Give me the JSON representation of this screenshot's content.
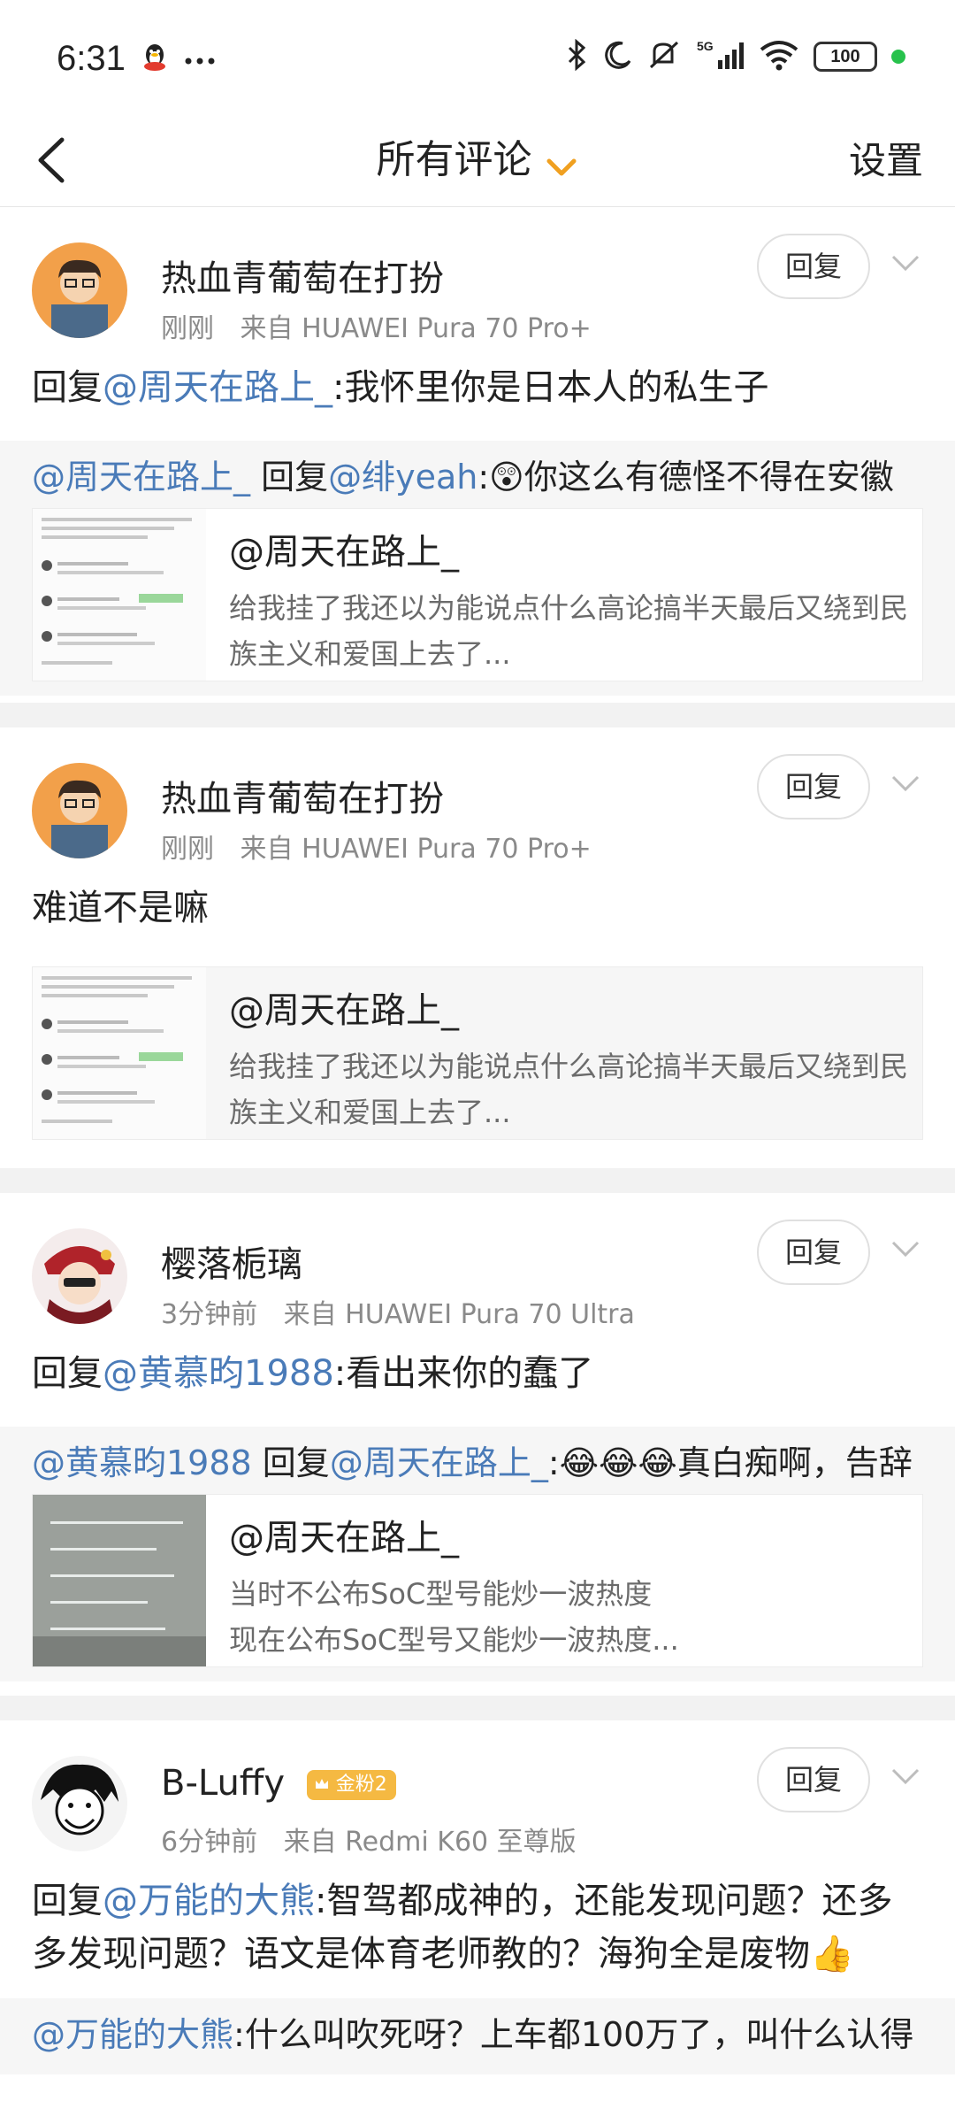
{
  "status_bar": {
    "time": "6:31",
    "left_icons": [
      "qq-penguin-icon",
      "more-dots-icon"
    ],
    "right_icons": [
      "bluetooth-icon",
      "moon-icon",
      "mute-icon",
      "signal-5g-icon",
      "wifi-icon"
    ],
    "network": "5G",
    "battery": "100"
  },
  "nav": {
    "title": "所有评论",
    "settings_label": "设置"
  },
  "comments": [
    {
      "username": "热血青葡萄在打扮",
      "time": "刚刚",
      "source": "来自 HUAWEI Pura 70 Pro+",
      "reply_label": "回复",
      "content_prefix": "回复",
      "content_mention": "@周天在路上_",
      "content_text": ":我怀里你是日本人的私生子",
      "quote_mention1": "@周天在路上_",
      "quote_reply_word": " 回复",
      "quote_mention2": "@绯yeah",
      "quote_text": ":😲你这么有德怪不得在安徽",
      "card_user": "@周天在路上_",
      "card_text": "给我挂了我还以为能说点什么高论搞半天最后又绕到民族主义和爱国上去了..."
    },
    {
      "username": "热血青葡萄在打扮",
      "time": "刚刚",
      "source": "来自 HUAWEI Pura 70 Pro+",
      "reply_label": "回复",
      "content_text": "难道不是嘛",
      "card_user": "@周天在路上_",
      "card_text": "给我挂了我还以为能说点什么高论搞半天最后又绕到民族主义和爱国上去了..."
    },
    {
      "username": "樱落栀璃",
      "time": "3分钟前",
      "source": "来自 HUAWEI Pura 70 Ultra",
      "reply_label": "回复",
      "content_prefix": "回复",
      "content_mention": "@黄慕昀1988",
      "content_text": ":看出来你的蠢了",
      "quote_mention1": "@黄慕昀1988",
      "quote_reply_word": " 回复",
      "quote_mention2": "@周天在路上_",
      "quote_text": ":😂😂😂真白痴啊，告辞",
      "card_user": "@周天在路上_",
      "card_text_line1": "当时不公布SoC型号能炒一波热度",
      "card_text_line2": "现在公布SoC型号又能炒一波热度..."
    },
    {
      "username": "B-Luffy",
      "badge": "金粉2",
      "time": "6分钟前",
      "source": "来自 Redmi K60 至尊版",
      "reply_label": "回复",
      "content_prefix": "回复",
      "content_mention": "@万能的大熊",
      "content_text": ":智驾都成神的，还能发现问题？还多多发现问题？语文是体育老师教的？海狗全是废物👍",
      "quote_mention1": "@万能的大熊",
      "quote_text": ":什么叫吹死呀？上车都100万了，叫什么认得"
    }
  ],
  "colors": {
    "mention": "#4a7bb8",
    "caret": "#f0a020",
    "meta": "#8a8a8a",
    "quote_bg": "#f6f6f6",
    "separator": "#f2f2f2"
  }
}
